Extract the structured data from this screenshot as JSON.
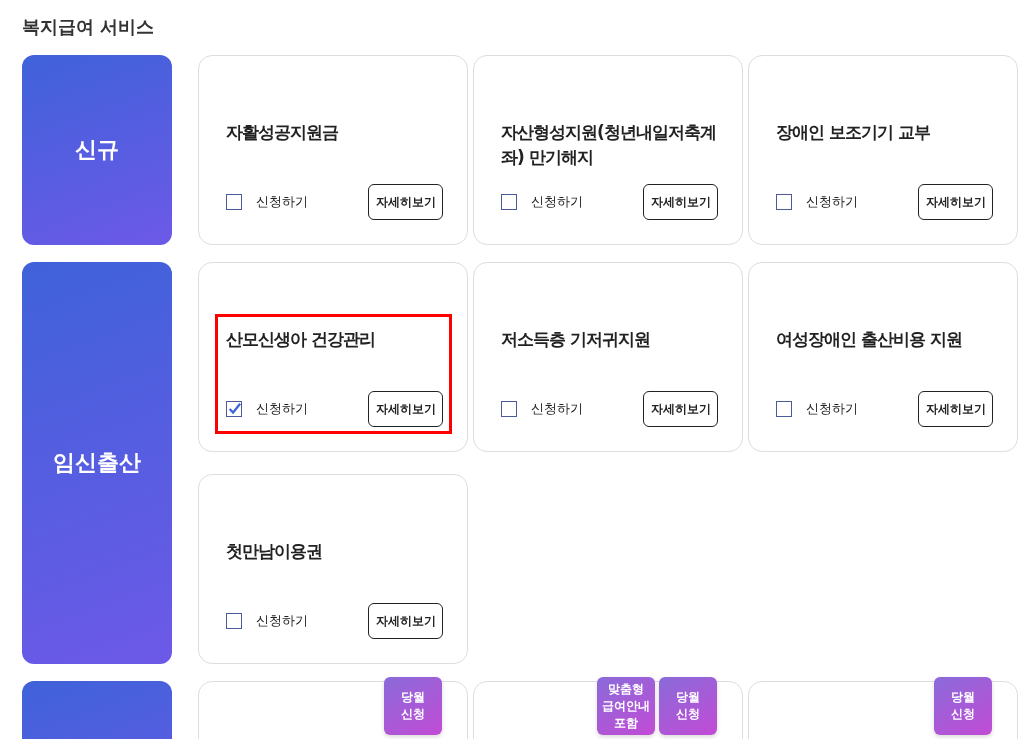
{
  "page_title": "복지급여 서비스",
  "groups": [
    {
      "label": "신규",
      "cards": [
        {
          "title": "자활성공지원금",
          "apply_label": "신청하기",
          "checked": false,
          "highlighted": false,
          "detail_button": "자세히보기"
        },
        {
          "title": "자산형성지원(청년내일저축계좌) 만기해지",
          "apply_label": "신청하기",
          "checked": false,
          "highlighted": false,
          "detail_button": "자세히보기"
        },
        {
          "title": "장애인 보조기기 교부",
          "apply_label": "신청하기",
          "checked": false,
          "highlighted": false,
          "detail_button": "자세히보기"
        }
      ]
    },
    {
      "label": "임신출산",
      "cards": [
        {
          "title": "산모신생아 건강관리",
          "apply_label": "신청하기",
          "checked": true,
          "highlighted": true,
          "detail_button": "자세히보기"
        },
        {
          "title": "저소득층 기저귀지원",
          "apply_label": "신청하기",
          "checked": false,
          "highlighted": false,
          "detail_button": "자세히보기"
        },
        {
          "title": "여성장애인 출산비용 지원",
          "apply_label": "신청하기",
          "checked": false,
          "highlighted": false,
          "detail_button": "자세히보기"
        },
        {
          "title": "첫만남이용권",
          "apply_label": "신청하기",
          "checked": false,
          "highlighted": false,
          "detail_button": "자세히보기"
        }
      ]
    },
    {
      "cards": [
        {
          "badges": [
            "당월\n신청"
          ]
        },
        {
          "badges": [
            "맞춤형\n급여안내\n포함",
            "당월\n신청"
          ]
        },
        {
          "badges": [
            "당월\n신청"
          ]
        }
      ]
    }
  ]
}
